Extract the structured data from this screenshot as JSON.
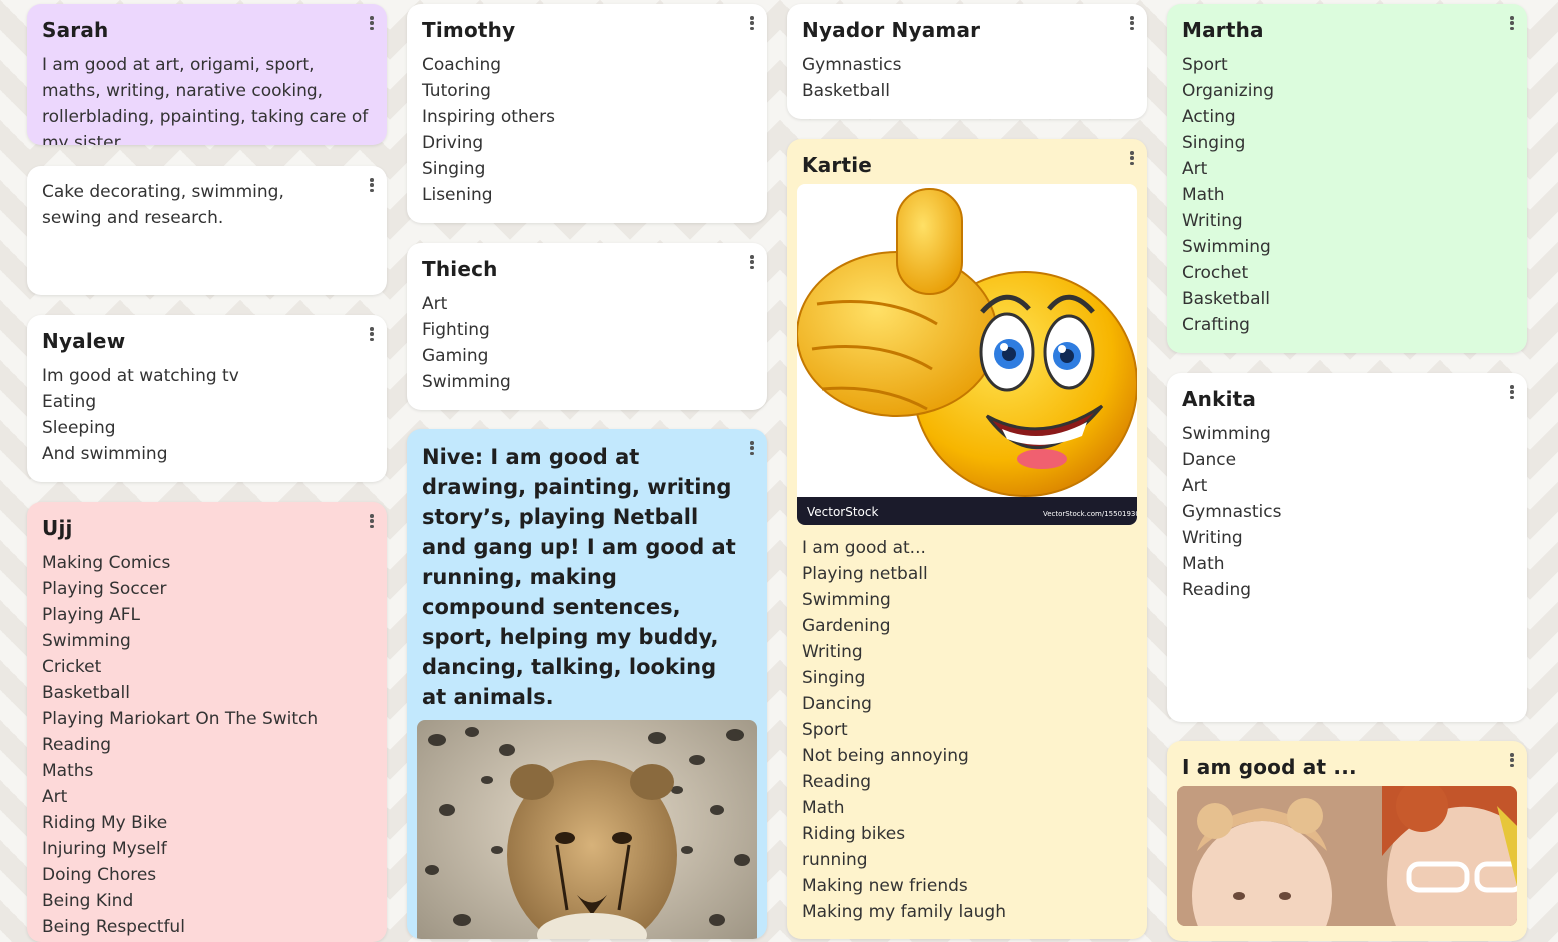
{
  "colors": {
    "lavender": "#ecd7fd",
    "white": "#ffffff",
    "pink": "#fdd9d9",
    "blue": "#c2e8fd",
    "yellow": "#fef3cc",
    "green": "#dcfcdd"
  },
  "cards": {
    "sarah": {
      "title": "Sarah",
      "text": "I am good at  art, origami, sport, maths, writing, narative cooking, rollerblading, ppainting, taking care of my sister,"
    },
    "cake": {
      "text": "Cake decorating, swimming, sewing and research."
    },
    "nyalew": {
      "title": "Nyalew",
      "lines": [
        "Im good at watching tv",
        "Eating",
        "Sleeping",
        "And swimming"
      ]
    },
    "ujj": {
      "title": "Ujj",
      "lines": [
        "Making Comics",
        "Playing Soccer",
        "Playing AFL",
        "Swimming",
        "Cricket",
        "Basketball",
        "Playing Mariokart On The Switch",
        "Reading",
        "Maths",
        "Art",
        "Riding My Bike",
        "Injuring Myself",
        "Doing Chores",
        "Being Kind",
        "Being Respectful"
      ]
    },
    "timothy": {
      "title": "Timothy",
      "lines": [
        "Coaching",
        "Tutoring",
        "Inspiring others",
        "Driving",
        "Singing",
        "Lisening"
      ]
    },
    "thiech": {
      "title": "Thiech",
      "lines": [
        "Art",
        "Fighting",
        "Gaming",
        "Swimming"
      ]
    },
    "nive": {
      "text": "Nive: I am good at drawing, painting, writing story’s, playing Netball and gang up! I am good at running, making compound sentences, sport, helping my buddy, dancing, talking, looking at animals.",
      "image_icon": "cheetah-cub-photo"
    },
    "nyador": {
      "title": "Nyador Nyamar",
      "lines": [
        "Gymnastics",
        "Basketball"
      ]
    },
    "kartie": {
      "title": "Kartie",
      "image_icon": "thumbs-up-smiley",
      "image_watermark_left": "VectorStock",
      "image_watermark_right": "VectorStock.com/15501930",
      "lines": [
        "I am good at...",
        "Playing netball",
        "Swimming",
        "Gardening",
        "Writing",
        "Singing",
        "Dancing",
        "Sport",
        "Not being annoying",
        "Reading",
        "Math",
        "Riding bikes",
        "running",
        "Making new friends",
        "Making my family laugh"
      ]
    },
    "martha": {
      "title": "Martha",
      "lines": [
        "Sport",
        "Organizing",
        "Acting",
        "Singing",
        "Art",
        "Math",
        "Writing",
        "Swimming",
        "Crochet",
        "Basketball",
        "Crafting"
      ]
    },
    "ankita": {
      "title": "Ankita",
      "lines": [
        "Swimming",
        "Dance",
        "Art",
        "Gymnastics",
        "Writing",
        "Math",
        "Reading"
      ]
    },
    "goodat": {
      "title": "I am good at ...",
      "image_icon": "children-photo"
    }
  }
}
